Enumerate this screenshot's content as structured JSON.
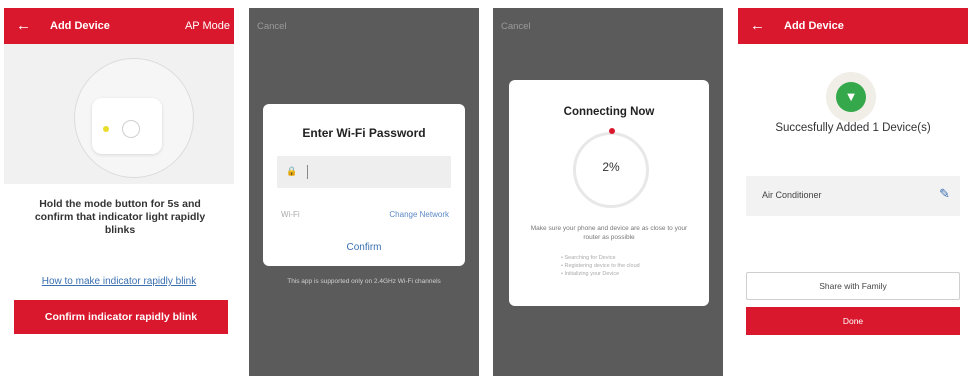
{
  "screen1": {
    "back_icon": "arrow-left-icon",
    "title": "Add Device",
    "mode": "AP Mode",
    "instruction": "Hold the mode button for 5s and confirm that indicator light rapidly blinks",
    "help_link": "How to make indicator rapidly blink",
    "confirm_button": "Confirm indicator rapidly blink"
  },
  "screen2": {
    "cancel": "Cancel",
    "dialog_title": "Enter Wi-Fi Password",
    "password_value": "",
    "wifi_label": "Wi-Fi",
    "change_network": "Change Network",
    "confirm": "Confirm",
    "note": "This app is supported only on 2.4GHz Wi-Fi channels"
  },
  "screen3": {
    "cancel": "Cancel",
    "title": "Connecting Now",
    "progress_percent": "2%",
    "message": "Make sure your phone and device are as close to your router as possible",
    "steps": [
      "Searching for Device",
      "Registering device to the cloud",
      "Initializing your Device"
    ]
  },
  "screen4": {
    "back_icon": "arrow-left-icon",
    "title": "Add Device",
    "success_text": "Succesfully Added 1 Device(s)",
    "device_name": "Air Conditioner",
    "share_button": "Share with Family",
    "done_button": "Done"
  },
  "colors": {
    "brand_red": "#d9182d",
    "dark_overlay": "#5b5b5b",
    "link_blue": "#3a6fb0",
    "success_green": "#34a84a"
  }
}
